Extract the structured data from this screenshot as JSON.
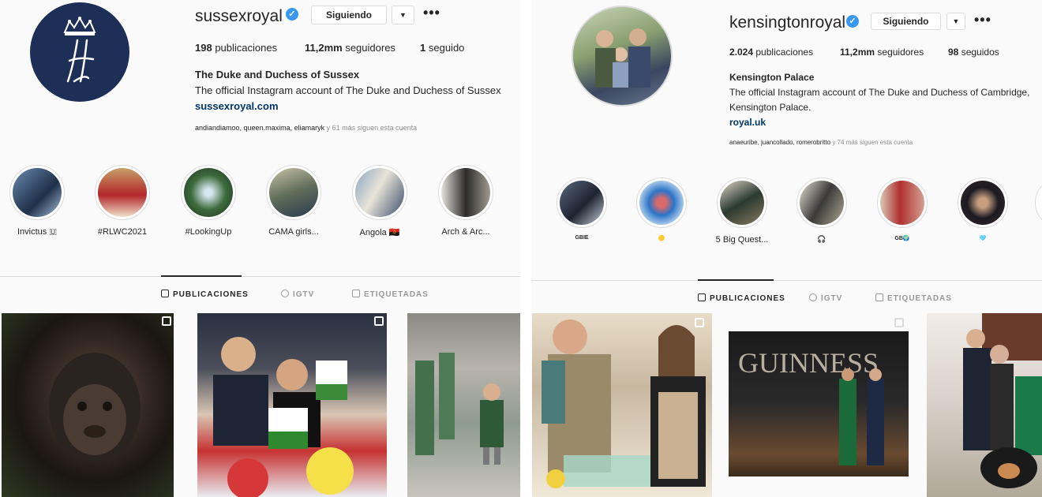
{
  "left": {
    "username": "sussexroyal",
    "follow_button": "Siguiendo",
    "stats": {
      "posts_num": "198",
      "posts_label": "publicaciones",
      "followers_num": "11,2mm",
      "followers_label": "seguidores",
      "following_num": "1",
      "following_label": "seguido"
    },
    "bio": {
      "name": "The Duke and Duchess of Sussex",
      "text": "The official Instagram account of The Duke and Duchess of Sussex",
      "link": "sussexroyal.com"
    },
    "followed_by": {
      "names": "andiandiamoo, queen.maxima, eliamaryk",
      "more": "y 61 más siguen esta cuenta"
    },
    "highlights": [
      {
        "label": "Invictus 🇺"
      },
      {
        "label": "#RLWC2021"
      },
      {
        "label": "#LookingUp"
      },
      {
        "label": "CAMA girls..."
      },
      {
        "label": "Angola 🇦🇴"
      },
      {
        "label": "Arch & Arc..."
      }
    ],
    "tabs": {
      "posts": "PUBLICACIONES",
      "igtv": "IGTV",
      "tagged": "ETIQUETADAS"
    }
  },
  "right": {
    "username": "kensingtonroyal",
    "follow_button": "Siguiendo",
    "stats": {
      "posts_num": "2.024",
      "posts_label": "publicaciones",
      "followers_num": "11,2mm",
      "followers_label": "seguidores",
      "following_num": "98",
      "following_label": "seguidos"
    },
    "bio": {
      "name": "Kensington Palace",
      "text": "The official Instagram account of The Duke and Duchess of Cambridge, Kensington Palace.",
      "link": "royal.uk"
    },
    "followed_by": {
      "names": "anaeuribe, juancollado, romerobritto",
      "more": "y 74 más siguen esta cuenta"
    },
    "highlights": [
      {
        "label": "GBIE"
      },
      {
        "label": "🟡"
      },
      {
        "label": "5 Big Quest..."
      },
      {
        "label": "🎧"
      },
      {
        "label": "GB🌍"
      },
      {
        "label": "🩵"
      }
    ],
    "tabs": {
      "posts": "PUBLICACIONES",
      "igtv": "IGTV",
      "tagged": "ETIQUETADAS"
    }
  },
  "colors": {
    "verified": "#3897f0",
    "link": "#003569",
    "avatar_navy": "#1d2f57"
  },
  "icons": {
    "verified": "verified-badge-icon",
    "more": "ellipsis-icon",
    "grid": "grid-icon",
    "igtv": "igtv-icon",
    "tagged": "tag-icon"
  }
}
